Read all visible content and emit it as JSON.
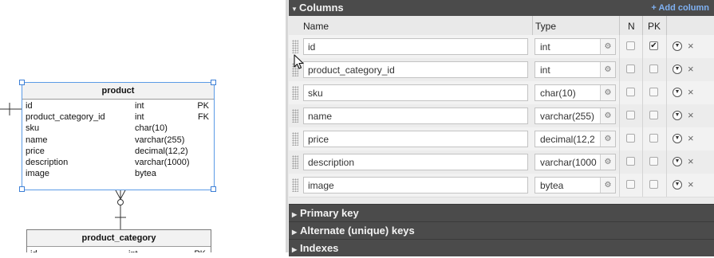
{
  "diagram": {
    "product": {
      "title": "product",
      "rows": [
        {
          "name": "id",
          "type": "int",
          "key": "PK"
        },
        {
          "name": "product_category_id",
          "type": "int",
          "key": "FK"
        },
        {
          "name": "sku",
          "type": "char(10)",
          "key": ""
        },
        {
          "name": "name",
          "type": "varchar(255)",
          "key": ""
        },
        {
          "name": "price",
          "type": "decimal(12,2)",
          "key": ""
        },
        {
          "name": "description",
          "type": "varchar(1000)",
          "key": ""
        },
        {
          "name": "image",
          "type": "bytea",
          "key": ""
        }
      ]
    },
    "product_category": {
      "title": "product_category",
      "rows": [
        {
          "name": "id",
          "type": "int",
          "key": "PK"
        }
      ]
    }
  },
  "panel": {
    "columns_section": {
      "title": "Columns",
      "add_label": "+ Add column"
    },
    "headers": {
      "name": "Name",
      "type": "Type",
      "n": "N",
      "pk": "PK"
    },
    "rows": [
      {
        "name": "id",
        "type": "int",
        "nullable": false,
        "pk": true
      },
      {
        "name": "product_category_id",
        "type": "int",
        "nullable": false,
        "pk": false
      },
      {
        "name": "sku",
        "type": "char(10)",
        "nullable": false,
        "pk": false
      },
      {
        "name": "name",
        "type": "varchar(255)",
        "nullable": false,
        "pk": false
      },
      {
        "name": "price",
        "type": "decimal(12,2",
        "nullable": false,
        "pk": false
      },
      {
        "name": "description",
        "type": "varchar(1000",
        "nullable": false,
        "pk": false
      },
      {
        "name": "image",
        "type": "bytea",
        "nullable": false,
        "pk": false
      }
    ],
    "collapsed_sections": [
      {
        "title": "Primary key"
      },
      {
        "title": "Alternate (unique) keys"
      },
      {
        "title": "Indexes"
      }
    ]
  },
  "icons": {
    "expand": "triangle-down-icon",
    "collapse": "triangle-right-icon",
    "type_picker": "gear-icon",
    "row_menu": "chevron-down-icon",
    "row_delete": "close-icon",
    "drag": "grip-icon",
    "cursor": "mouse-pointer-icon"
  },
  "colors": {
    "section_bar": "#4b4b4b",
    "add_link": "#7fb1f2",
    "selection": "#5b9be6"
  }
}
